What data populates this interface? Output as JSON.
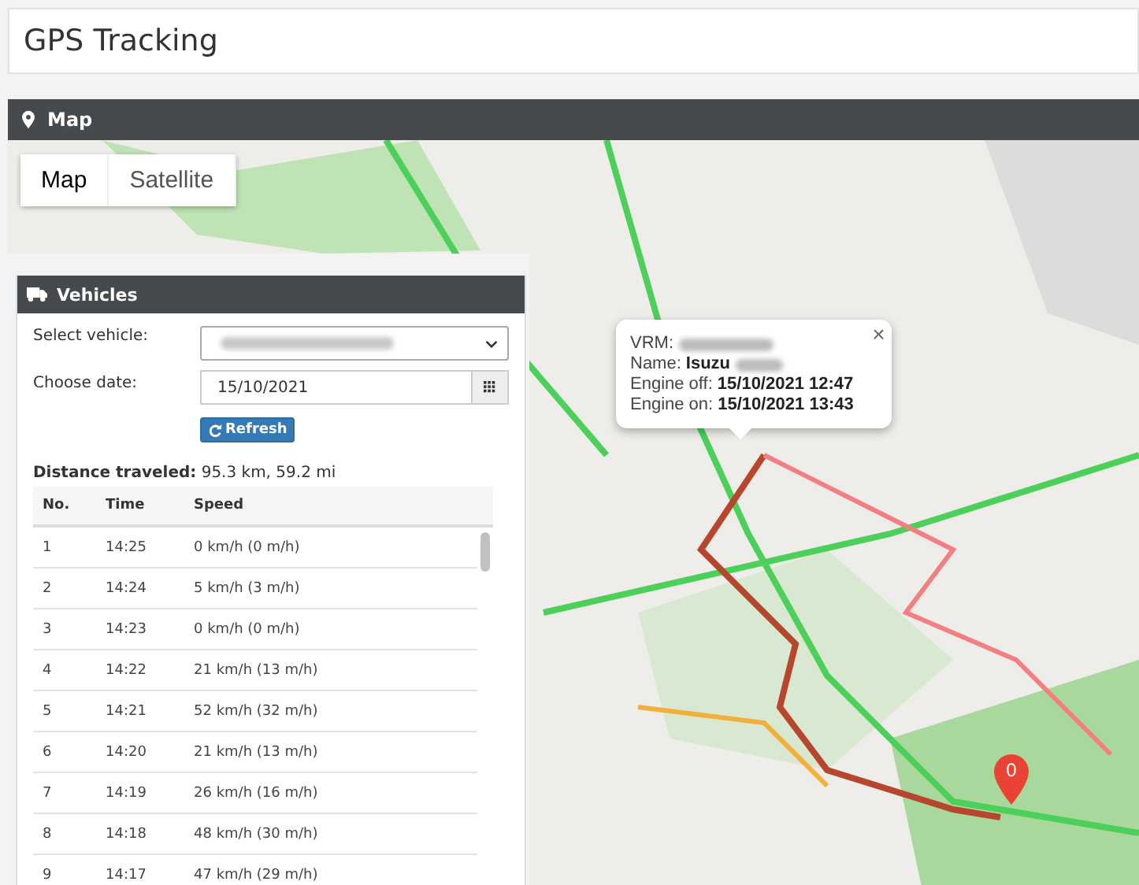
{
  "page_title": "GPS Tracking",
  "map_panel": {
    "title": "Map",
    "map_types": [
      {
        "label": "Map",
        "selected": true
      },
      {
        "label": "Satellite",
        "selected": false
      }
    ],
    "popup": {
      "vrm_label": "VRM:",
      "name_label": "Name:",
      "name_value": "Isuzu",
      "engine_off_label": "Engine off:",
      "engine_off_value": "15/10/2021 12:47",
      "engine_on_label": "Engine on:",
      "engine_on_value": "15/10/2021 13:43",
      "close": "×"
    },
    "marker": {
      "label": "0"
    }
  },
  "vehicles_panel": {
    "title": "Vehicles",
    "select_label": "Select vehicle:",
    "date_label": "Choose date:",
    "date_value": "15/10/2021",
    "refresh_button": "Refresh",
    "distance_label": "Distance traveled:",
    "distance_value": "95.3 km, 59.2 mi",
    "table": {
      "columns": [
        "No.",
        "Time",
        "Speed"
      ],
      "rows": [
        [
          "1",
          "14:25",
          "0 km/h (0 m/h)"
        ],
        [
          "2",
          "14:24",
          "5 km/h (3 m/h)"
        ],
        [
          "3",
          "14:23",
          "0 km/h (0 m/h)"
        ],
        [
          "4",
          "14:22",
          "21 km/h (13 m/h)"
        ],
        [
          "5",
          "14:21",
          "52 km/h (32 m/h)"
        ],
        [
          "6",
          "14:20",
          "21 km/h (13 m/h)"
        ],
        [
          "7",
          "14:19",
          "26 km/h (16 m/h)"
        ],
        [
          "8",
          "14:18",
          "48 km/h (30 m/h)"
        ],
        [
          "9",
          "14:17",
          "47 km/h (29 m/h)"
        ]
      ]
    }
  }
}
